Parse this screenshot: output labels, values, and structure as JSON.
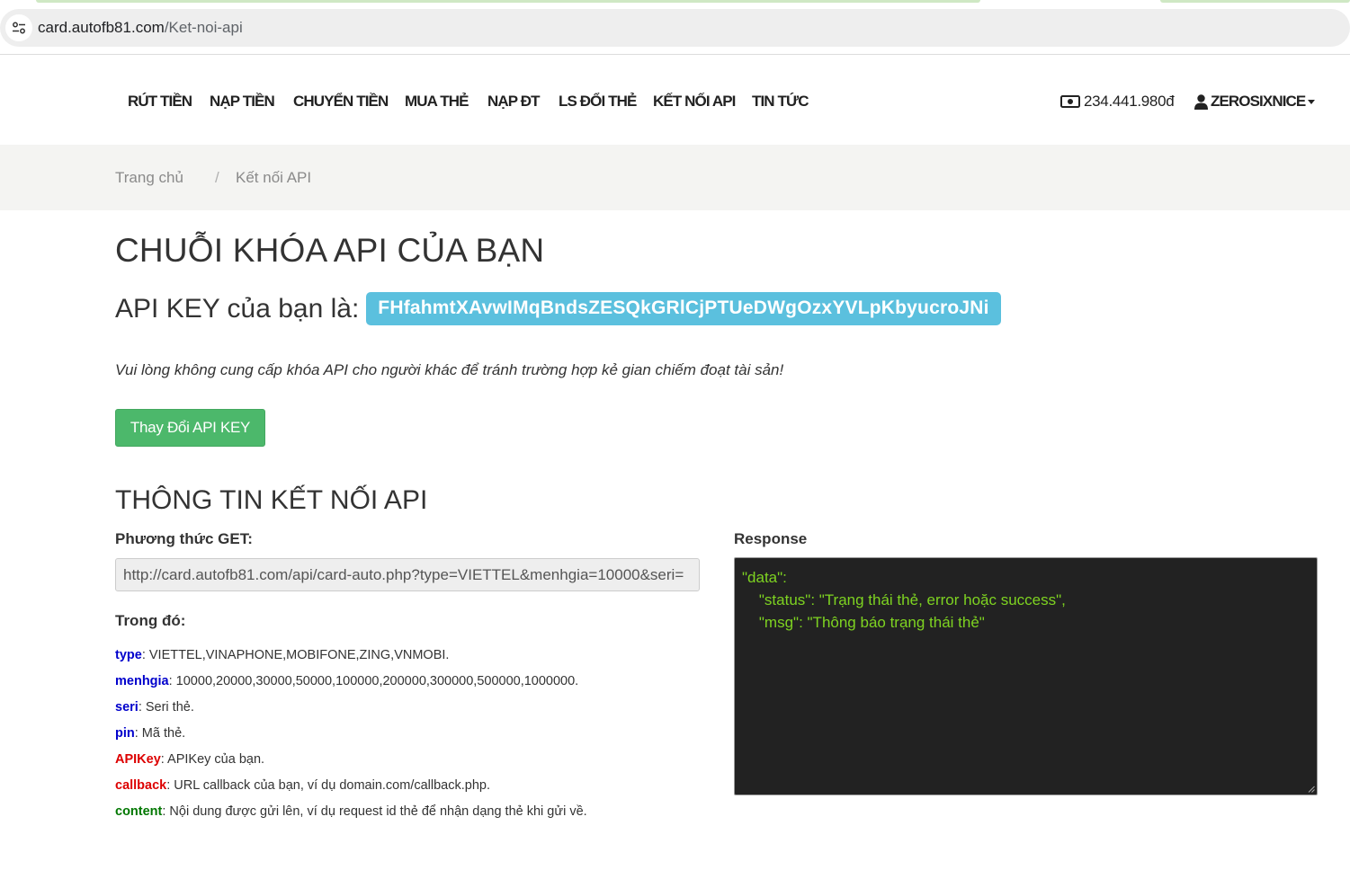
{
  "browser": {
    "url_domain": "card.autofb81.com",
    "url_path": "/Ket-noi-api"
  },
  "nav": {
    "items": [
      {
        "label": "RÚT TIỀN"
      },
      {
        "label": "NẠP TIỀN"
      },
      {
        "label": "CHUYỂN TIỀN"
      },
      {
        "label": "MUA THẺ"
      },
      {
        "label": "NẠP ĐT"
      },
      {
        "label": "LS ĐỔI THẺ"
      },
      {
        "label": "KẾT NỐI API"
      },
      {
        "label": "TIN TỨC"
      }
    ],
    "balance": "234.441.980đ",
    "username": "ZEROSIXNICE"
  },
  "breadcrumb": {
    "home": "Trang chủ",
    "separator": "/",
    "current": "Kết nối API"
  },
  "main": {
    "title": "CHUỖI KHÓA API CỦA BẠN",
    "apikey_label": "API KEY của bạn là:",
    "apikey_value": "FHfahmtXAvwIMqBndsZESQkGRlCjPTUeDWgOzxYVLpKbyucroJNi",
    "warning": "Vui lòng không cung cấp khóa API cho người khác để tránh trường hợp kẻ gian chiếm đoạt tài sản!",
    "change_button": "Thay Đổi API KEY",
    "section_title": "THÔNG TIN KẾT NỐI API",
    "get_label": "Phương thức GET:",
    "get_url": "http://card.autofb81.com/api/card-auto.php?type=VIETTEL&menhgia=10000&seri=",
    "where_label": "Trong đó:",
    "params": [
      {
        "key": "type",
        "desc": ": VIETTEL,VINAPHONE,MOBIFONE,ZING,VNMOBI."
      },
      {
        "key": "menhgia",
        "desc": ": 10000,20000,30000,50000,100000,200000,300000,500000,1000000."
      },
      {
        "key": "seri",
        "desc": ": Seri thẻ."
      },
      {
        "key": "pin",
        "desc": ": Mã thẻ."
      },
      {
        "key": "APIKey",
        "desc": ": APIKey của bạn."
      },
      {
        "key": "callback",
        "desc": ": URL callback của bạn, ví dụ domain.com/callback.php."
      },
      {
        "key": "content",
        "desc": ": Nội dung được gửi lên, ví dụ request id thẻ để nhận dạng thẻ khi gửi về."
      }
    ],
    "response_label": "Response",
    "response_text": "\"data\":\n    \"status\": \"Trạng thái thẻ, error hoặc success\",\n    \"msg\": \"Thông báo trạng thái thẻ\""
  },
  "colors": {
    "param_blue": "#0000cc",
    "param_red": "#dd0000",
    "param_green": "#007700",
    "badge": "#5bc0de",
    "button": "#4cb86b",
    "response_text": "#7ed321"
  }
}
